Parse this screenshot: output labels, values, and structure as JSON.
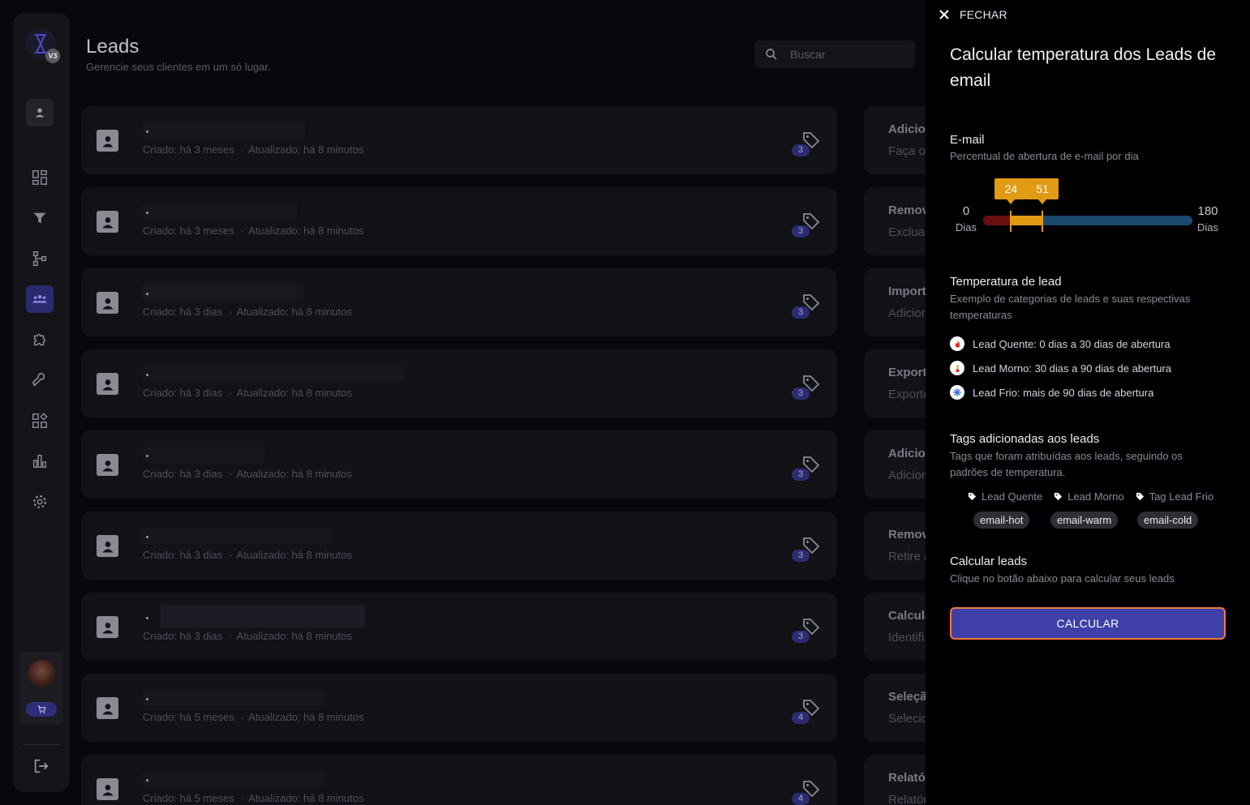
{
  "header": {
    "title": "Leads",
    "subtitle": "Gerencie seus clientes em um só lugar.",
    "search_placeholder": "Buscar"
  },
  "sidebar": {
    "logo_badge": "V3",
    "items": [
      {
        "icon": "user-icon"
      },
      {
        "icon": "dashboard-icon"
      },
      {
        "icon": "funnel-icon"
      },
      {
        "icon": "flow-icon"
      },
      {
        "icon": "leads-group-icon",
        "active": true
      },
      {
        "icon": "puzzle-icon"
      },
      {
        "icon": "wrench-icon"
      },
      {
        "icon": "apps-icon"
      },
      {
        "icon": "bar-chart-icon"
      },
      {
        "icon": "gear-icon"
      }
    ]
  },
  "leads": [
    {
      "created": "Criado: há 3 meses",
      "updated": "Atualizado: há 8 minutos",
      "tag_count": "3"
    },
    {
      "created": "Criado: há 3 meses",
      "updated": "Atualizado: há 8 minutos",
      "tag_count": "3"
    },
    {
      "created": "Criado: há 3 dias",
      "updated": "Atualizado: há 8 minutos",
      "tag_count": "3"
    },
    {
      "created": "Criado: há 3 dias",
      "updated": "Atualizado: há 8 minutos",
      "tag_count": "3"
    },
    {
      "created": "Criado: há 3 dias",
      "updated": "Atualizado: há 8 minutos",
      "tag_count": "3"
    },
    {
      "created": "Criado: há 3 dias",
      "updated": "Atualizado: há 8 minutos",
      "tag_count": "3"
    },
    {
      "created": "Criado: há 3 dias",
      "updated": "Atualizado: há 8 minutos",
      "tag_count": "3"
    },
    {
      "created": "Criado: há 5 meses",
      "updated": "Atualizado: há 8 minutos",
      "tag_count": "4"
    },
    {
      "created": "Criado: há 5 meses",
      "updated": "Atualizado: há 8 minutos",
      "tag_count": "4"
    }
  ],
  "actions": [
    {
      "title": "Adicio",
      "desc": "Faça o"
    },
    {
      "title": "Remov",
      "desc": "Exclua"
    },
    {
      "title": "Import",
      "desc": "Adicion"
    },
    {
      "title": "Export",
      "desc": "Exporte"
    },
    {
      "title": "Adicio",
      "desc": "Adicion"
    },
    {
      "title": "Remov",
      "desc": "Retire a"
    },
    {
      "title": "Calcula",
      "desc": "Identifi"
    },
    {
      "title": "Seleçã",
      "desc": "Selecio"
    },
    {
      "title": "Relató",
      "desc": "Relatór"
    }
  ],
  "drawer": {
    "close_label": "FECHAR",
    "title": "Calcular temperatura dos Leads de email",
    "email_title": "E-mail",
    "email_desc": "Percentual de abertura de e-mail por dia",
    "slider": {
      "min": "0",
      "max": "180",
      "unit": "Dias",
      "low_value": "24",
      "high_value": "51",
      "min_num": 0,
      "max_num": 180,
      "low_num": 24,
      "high_num": 51
    },
    "temp_title": "Temperatura de lead",
    "temp_desc": "Exemplo de categorias de leads e suas respectivas temperaturas",
    "temperatures": [
      {
        "icon": "fire-icon",
        "label": "Lead Quente: 0 dias a 30 dias de abertura",
        "color": "#e0301c"
      },
      {
        "icon": "thermometer-icon",
        "label": "Lead Morno: 30 dias a 90 dias de abertura",
        "color": "#f08a24"
      },
      {
        "icon": "snowflake-icon",
        "label": "Lead Frio: mais de 90 dias de abertura",
        "color": "#2a6ce0"
      }
    ],
    "tags_title": "Tags adicionadas aos leads",
    "tags_desc": "Tags que foram atribuídas aos leads, seguindo os padrões de temperatura.",
    "tag_names": [
      "Lead Quente",
      "Lead Morno",
      "Tag Lead Frio"
    ],
    "tag_chips": [
      "email-hot",
      "email-warm",
      "email-cold"
    ],
    "calc_title": "Calcular leads",
    "calc_desc": "Clique no botão abaixo para calcular seus leads",
    "calc_button": "CALCULAR"
  },
  "colors": {
    "accent": "#3f3fa8",
    "focus_ring": "#f07a3c",
    "warm": "#e09a14",
    "hot": "#6b1010",
    "cold": "#1a4a70"
  }
}
